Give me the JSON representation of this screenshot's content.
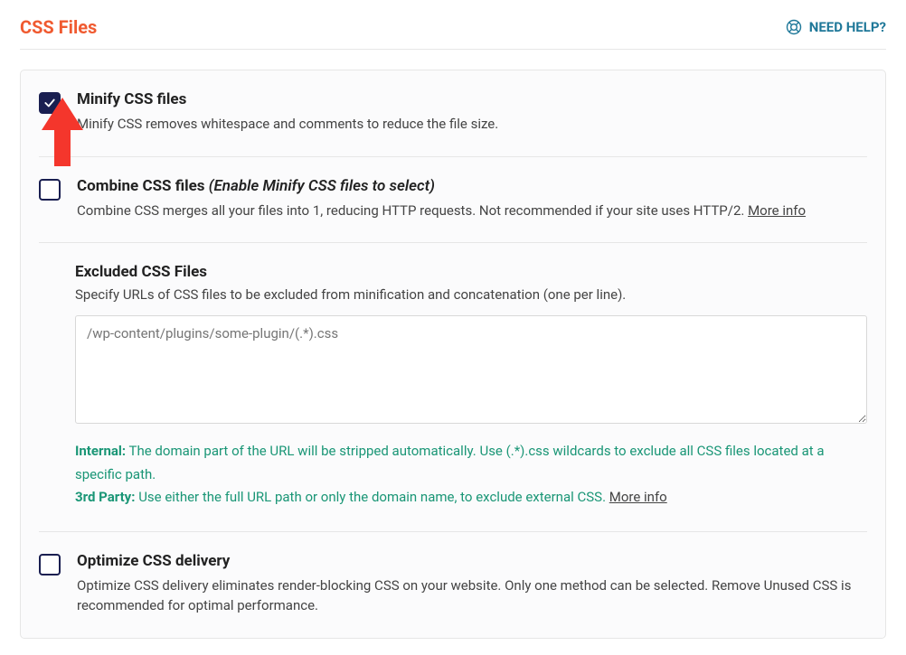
{
  "header": {
    "title": "CSS Files",
    "help_label": "NEED HELP?"
  },
  "options": {
    "minify": {
      "title": "Minify CSS files",
      "desc": "Minify CSS removes whitespace and comments to reduce the file size."
    },
    "combine": {
      "title_base": "Combine CSS files ",
      "title_hint": "(Enable Minify CSS files to select)",
      "desc": "Combine CSS merges all your files into 1, reducing HTTP requests. Not recommended if your site uses HTTP/2. ",
      "more": "More info"
    },
    "excluded": {
      "heading": "Excluded CSS Files",
      "desc": "Specify URLs of CSS files to be excluded from minification and concatenation (one per line).",
      "placeholder": "/wp-content/plugins/some-plugin/(.*).css",
      "internal_label": "Internal:",
      "internal_text": " The domain part of the URL will be stripped automatically. Use (.*).css wildcards to exclude all CSS files located at a specific path.",
      "third_label": "3rd Party:",
      "third_text": " Use either the full URL path or only the domain name, to exclude external CSS. ",
      "more": "More info"
    },
    "optimize": {
      "title": "Optimize CSS delivery",
      "desc": "Optimize CSS delivery eliminates render-blocking CSS on your website. Only one method can be selected. Remove Unused CSS is recommended for optimal performance."
    }
  }
}
